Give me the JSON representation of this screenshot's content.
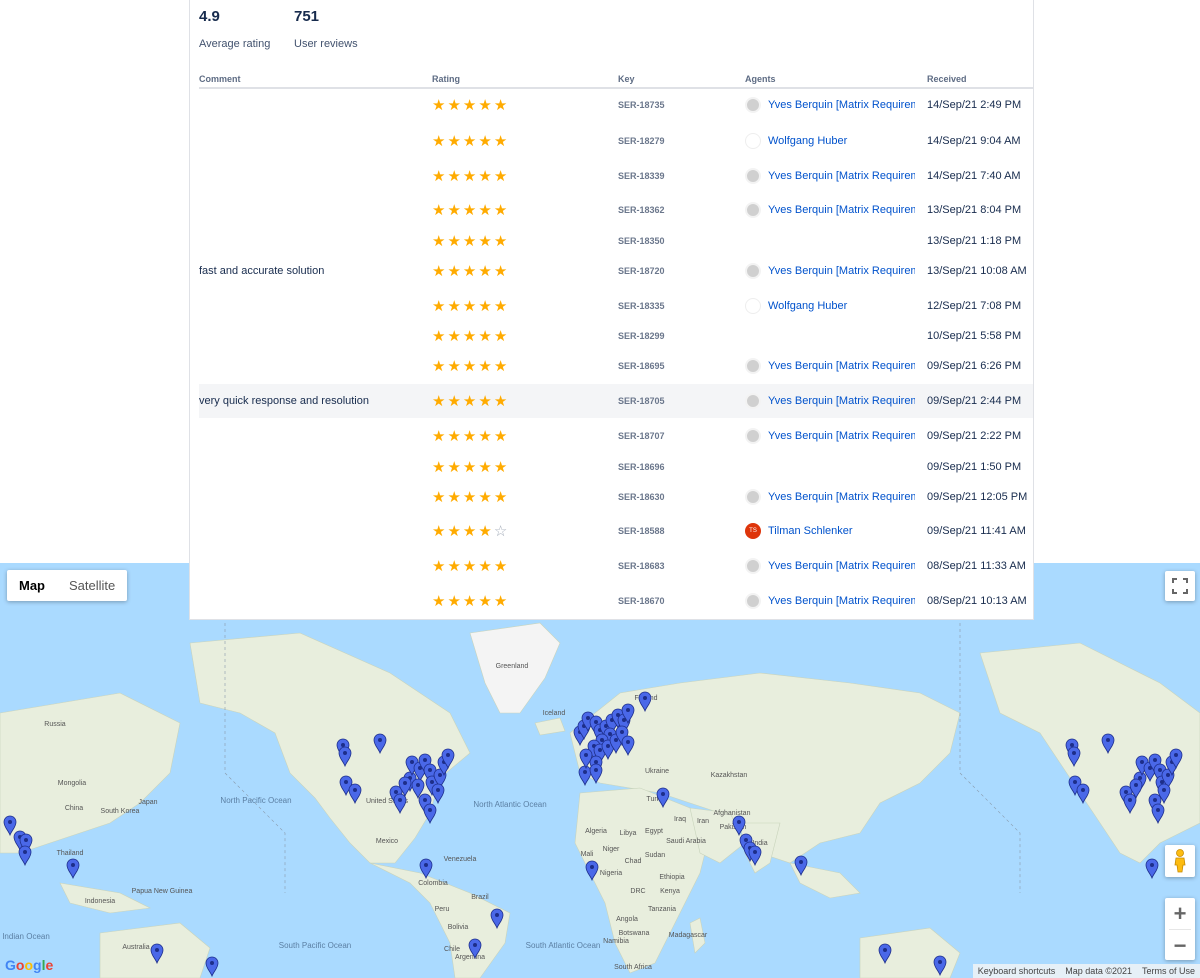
{
  "summary": {
    "avg_rating": "4.9",
    "avg_rating_label": "Average rating",
    "review_count": "751",
    "review_count_label": "User reviews"
  },
  "table": {
    "headers": {
      "comment": "Comment",
      "rating": "Rating",
      "key": "Key",
      "agents": "Agents",
      "received": "Received"
    },
    "rows": [
      {
        "comment": "",
        "rating": 5,
        "key": "SER-18735",
        "agent": "Yves Berquin [Matrix Requirements]",
        "avatar": "yb",
        "received": "14/Sep/21 2:49 PM"
      },
      {
        "comment": "",
        "rating": 5,
        "key": "SER-18279",
        "agent": "Wolfgang Huber",
        "avatar": "wh",
        "received": "14/Sep/21 9:04 AM"
      },
      {
        "comment": "",
        "rating": 5,
        "key": "SER-18339",
        "agent": "Yves Berquin [Matrix Requirements]",
        "avatar": "yb",
        "received": "14/Sep/21 7:40 AM"
      },
      {
        "comment": "",
        "rating": 5,
        "key": "SER-18362",
        "agent": "Yves Berquin [Matrix Requirements]",
        "avatar": "yb",
        "received": "13/Sep/21 8:04 PM"
      },
      {
        "comment": "",
        "rating": 5,
        "key": "SER-18350",
        "agent": "",
        "avatar": "",
        "received": "13/Sep/21 1:18 PM"
      },
      {
        "comment": "fast and accurate solution",
        "rating": 5,
        "key": "SER-18720",
        "agent": "Yves Berquin [Matrix Requirements]",
        "avatar": "yb",
        "received": "13/Sep/21 10:08 AM"
      },
      {
        "comment": "",
        "rating": 5,
        "key": "SER-18335",
        "agent": "Wolfgang Huber",
        "avatar": "wh",
        "received": "12/Sep/21 7:08 PM"
      },
      {
        "comment": "",
        "rating": 5,
        "key": "SER-18299",
        "agent": "",
        "avatar": "",
        "received": "10/Sep/21 5:58 PM"
      },
      {
        "comment": "",
        "rating": 5,
        "key": "SER-18695",
        "agent": "Yves Berquin [Matrix Requirements]",
        "avatar": "yb",
        "received": "09/Sep/21 6:26 PM"
      },
      {
        "comment": "very quick response and resolution",
        "rating": 5,
        "key": "SER-18705",
        "agent": "Yves Berquin [Matrix Requirements]",
        "avatar": "yb",
        "received": "09/Sep/21 2:44 PM"
      },
      {
        "comment": "",
        "rating": 5,
        "key": "SER-18707",
        "agent": "Yves Berquin [Matrix Requirements]",
        "avatar": "yb",
        "received": "09/Sep/21 2:22 PM"
      },
      {
        "comment": "",
        "rating": 5,
        "key": "SER-18696",
        "agent": "",
        "avatar": "",
        "received": "09/Sep/21 1:50 PM"
      },
      {
        "comment": "",
        "rating": 5,
        "key": "SER-18630",
        "agent": "Yves Berquin [Matrix Requirements]",
        "avatar": "yb",
        "received": "09/Sep/21 12:05 PM"
      },
      {
        "comment": "",
        "rating": 4,
        "key": "SER-18588",
        "agent": "Tilman Schlenker",
        "avatar": "ts",
        "avatar_initials": "TS",
        "received": "09/Sep/21 11:41 AM"
      },
      {
        "comment": "",
        "rating": 5,
        "key": "SER-18683",
        "agent": "Yves Berquin [Matrix Requirements]",
        "avatar": "yb",
        "received": "08/Sep/21 11:33 AM"
      },
      {
        "comment": "",
        "rating": 5,
        "key": "SER-18670",
        "agent": "Yves Berquin [Matrix Requirements]",
        "avatar": "yb",
        "received": "08/Sep/21 10:13 AM"
      }
    ]
  },
  "map": {
    "map_type_options": [
      "Map",
      "Satellite"
    ],
    "selected_map_type": "Map",
    "zoom_in": "+",
    "zoom_out": "−",
    "fullscreen_icon": "fullscreen-icon",
    "pegman_icon": "pegman-icon",
    "logo_text": "Google",
    "attribution": {
      "shortcuts": "Keyboard shortcuts",
      "data": "Map data ©2021",
      "terms": "Terms of Use"
    },
    "labels": [
      {
        "text": "Greenland"
      },
      {
        "text": "Iceland"
      },
      {
        "text": "Finland"
      },
      {
        "text": "Russia"
      },
      {
        "text": "Mongolia"
      },
      {
        "text": "China"
      },
      {
        "text": "South Korea"
      },
      {
        "text": "Japan"
      },
      {
        "text": "Thailand"
      },
      {
        "text": "Indonesia"
      },
      {
        "text": "Papua New Guinea"
      },
      {
        "text": "Australia"
      },
      {
        "text": "Indian Ocean"
      },
      {
        "text": "North Pacific Ocean"
      },
      {
        "text": "United States"
      },
      {
        "text": "Mexico"
      },
      {
        "text": "Venezuela"
      },
      {
        "text": "Colombia"
      },
      {
        "text": "Peru"
      },
      {
        "text": "Brazil"
      },
      {
        "text": "Bolivia"
      },
      {
        "text": "Chile"
      },
      {
        "text": "Argentina"
      },
      {
        "text": "South Pacific Ocean"
      },
      {
        "text": "North Atlantic Ocean"
      },
      {
        "text": "South Atlantic Ocean"
      },
      {
        "text": "Ukraine"
      },
      {
        "text": "Kazakhstan"
      },
      {
        "text": "Turkey"
      },
      {
        "text": "Iraq"
      },
      {
        "text": "Iran"
      },
      {
        "text": "Afghanistan"
      },
      {
        "text": "Pakistan"
      },
      {
        "text": "India"
      },
      {
        "text": "Algeria"
      },
      {
        "text": "Libya"
      },
      {
        "text": "Egypt"
      },
      {
        "text": "Saudi Arabia"
      },
      {
        "text": "Mali"
      },
      {
        "text": "Niger"
      },
      {
        "text": "Chad"
      },
      {
        "text": "Sudan"
      },
      {
        "text": "Nigeria"
      },
      {
        "text": "Ethiopia"
      },
      {
        "text": "DRC"
      },
      {
        "text": "Kenya"
      },
      {
        "text": "Tanzania"
      },
      {
        "text": "Angola"
      },
      {
        "text": "Namibia"
      },
      {
        "text": "Botswana"
      },
      {
        "text": "Madagascar"
      },
      {
        "text": "South Africa"
      }
    ]
  }
}
